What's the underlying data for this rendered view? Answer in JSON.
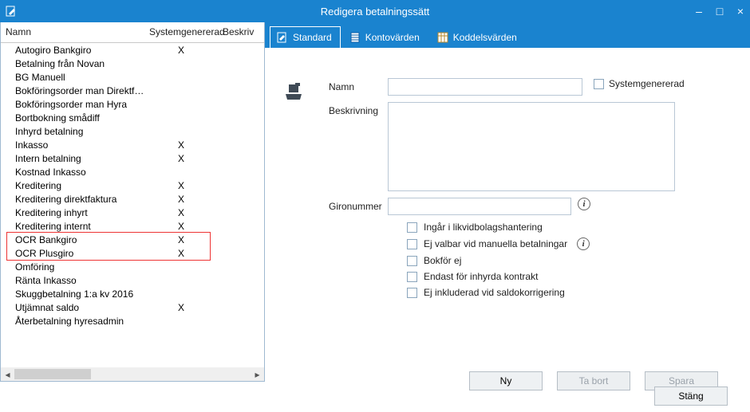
{
  "window": {
    "title": "Redigera betalningssätt",
    "minimize": "–",
    "maximize": "□",
    "close": "×"
  },
  "table": {
    "headers": {
      "name": "Namn",
      "sys": "Systemgenererad",
      "desc": "Beskriv"
    },
    "rows": [
      {
        "name": "Autogiro Bankgiro",
        "sys": "X"
      },
      {
        "name": "Betalning från Novan",
        "sys": ""
      },
      {
        "name": "BG Manuell",
        "sys": ""
      },
      {
        "name": "Bokföringsorder man Direktfakt",
        "sys": ""
      },
      {
        "name": "Bokföringsorder man Hyra",
        "sys": ""
      },
      {
        "name": "Bortbokning smådiff",
        "sys": ""
      },
      {
        "name": "Inhyrd betalning",
        "sys": ""
      },
      {
        "name": "Inkasso",
        "sys": "X"
      },
      {
        "name": "Intern betalning",
        "sys": "X"
      },
      {
        "name": "Kostnad Inkasso",
        "sys": ""
      },
      {
        "name": "Kreditering",
        "sys": "X"
      },
      {
        "name": "Kreditering direktfaktura",
        "sys": "X"
      },
      {
        "name": "Kreditering inhyrt",
        "sys": "X"
      },
      {
        "name": "Kreditering internt",
        "sys": "X"
      },
      {
        "name": "OCR Bankgiro",
        "sys": "X"
      },
      {
        "name": "OCR Plusgiro",
        "sys": "X"
      },
      {
        "name": "Omföring",
        "sys": ""
      },
      {
        "name": "Ränta Inkasso",
        "sys": ""
      },
      {
        "name": "Skuggbetalning 1:a kv 2016",
        "sys": ""
      },
      {
        "name": "Utjämnat saldo",
        "sys": "X"
      },
      {
        "name": "Återbetalning hyresadmin",
        "sys": ""
      }
    ]
  },
  "tabs": {
    "standard": "Standard",
    "konto": "Kontovärden",
    "koddel": "Koddelsvärden"
  },
  "form": {
    "name_label": "Namn",
    "sysgen_label": "Systemgenererad",
    "desc_label": "Beskrivning",
    "giro_label": "Gironummer",
    "name_value": "",
    "desc_value": "",
    "giro_value": "",
    "checks": {
      "likvid": "Ingår i likvidbolagshantering",
      "ejvalbar": "Ej valbar vid manuella betalningar",
      "bokfor": "Bokför ej",
      "inhyrda": "Endast för inhyrda kontrakt",
      "saldo": "Ej inkluderad vid saldokorrigering"
    }
  },
  "buttons": {
    "new": "Ny",
    "delete": "Ta bort",
    "save": "Spara",
    "close": "Stäng"
  },
  "info_glyph": "i"
}
